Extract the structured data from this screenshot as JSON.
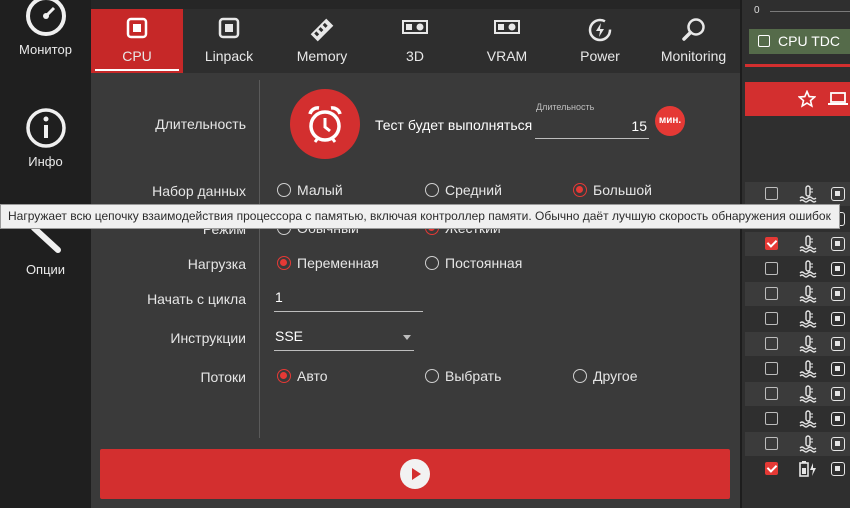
{
  "sidebar": {
    "items": [
      {
        "label": "Монитор",
        "icon": "gauge-icon"
      },
      {
        "label": "Инфо",
        "icon": "info-icon"
      },
      {
        "label": "Опции",
        "icon": "wrench-icon"
      }
    ]
  },
  "tabs": [
    {
      "label": "CPU",
      "icon": "cpu-icon",
      "active": true
    },
    {
      "label": "Linpack",
      "icon": "chip-icon",
      "active": false
    },
    {
      "label": "Memory",
      "icon": "memory-icon",
      "active": false
    },
    {
      "label": "3D",
      "icon": "gpu-icon",
      "active": false
    },
    {
      "label": "VRAM",
      "icon": "vram-icon",
      "active": false
    },
    {
      "label": "Power",
      "icon": "power-icon",
      "active": false
    },
    {
      "label": "Monitoring",
      "icon": "magnifier-icon",
      "active": false
    }
  ],
  "form": {
    "duration": {
      "label": "Длительность",
      "test_text": "Тест будет выполняться",
      "caption": "Длительность",
      "value": "15",
      "unit": "мин."
    },
    "dataset": {
      "label": "Набор данных",
      "options": [
        "Малый",
        "Средний",
        "Большой"
      ],
      "selected": "Большой"
    },
    "mode": {
      "label": "Режим",
      "options": [
        "Обычный",
        "Жесткий"
      ],
      "selected": "Жесткий"
    },
    "load": {
      "label": "Нагрузка",
      "options": [
        "Переменная",
        "Постоянная"
      ],
      "selected": "Переменная"
    },
    "start_cycle": {
      "label": "Начать с цикла",
      "value": "1"
    },
    "instructions": {
      "label": "Инструкции",
      "value": "SSE"
    },
    "threads": {
      "label": "Потоки",
      "options": [
        "Авто",
        "Выбрать",
        "Другое"
      ],
      "selected": "Авто"
    }
  },
  "tooltip": "Нагружает всю цепочку взаимодействия процессора с памятью, включая контроллер памяти. Обычно даёт лучшую скорость обнаружения ошибок",
  "right_panel": {
    "scale_zero": "0",
    "sensor_title": "CPU TDC",
    "rows": [
      {
        "checked": false,
        "icon": "temperature-icon"
      },
      {
        "checked": false,
        "icon": "temperature-icon"
      },
      {
        "checked": true,
        "icon": "temperature-icon"
      },
      {
        "checked": false,
        "icon": "temperature-icon"
      },
      {
        "checked": false,
        "icon": "temperature-icon"
      },
      {
        "checked": false,
        "icon": "temperature-icon"
      },
      {
        "checked": false,
        "icon": "temperature-icon"
      },
      {
        "checked": false,
        "icon": "temperature-icon"
      },
      {
        "checked": false,
        "icon": "temperature-icon"
      },
      {
        "checked": false,
        "icon": "temperature-icon"
      },
      {
        "checked": false,
        "icon": "temperature-icon"
      },
      {
        "checked": true,
        "icon": "battery-icon"
      }
    ]
  },
  "colors": {
    "accent": "#d32f2f",
    "sensor_header": "#556b4a",
    "background": "#3a3a3a"
  }
}
